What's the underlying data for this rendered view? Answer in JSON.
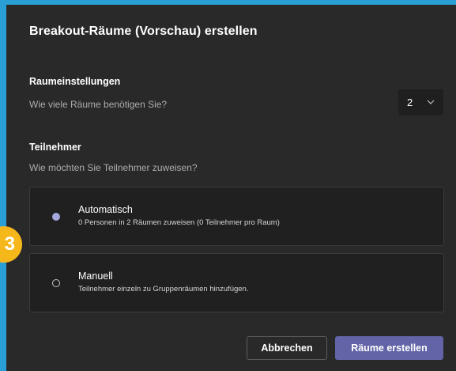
{
  "dialog": {
    "title": "Breakout-Räume (Vorschau) erstellen"
  },
  "room_settings": {
    "heading": "Raumeinstellungen",
    "question": "Wie viele Räume benötigen Sie?",
    "room_count": "2"
  },
  "participants": {
    "heading": "Teilnehmer",
    "question": "Wie möchten Sie Teilnehmer zuweisen?",
    "options": [
      {
        "label": "Automatisch",
        "description": "0 Personen in 2 Räumen zuweisen (0 Teilnehmer pro Raum)",
        "selected": true
      },
      {
        "label": "Manuell",
        "description": "Teilnehmer einzeln zu Gruppenräumen hinzufügen.",
        "selected": false
      }
    ]
  },
  "actions": {
    "cancel_label": "Abbrechen",
    "create_label": "Räume erstellen"
  },
  "step_badge": "3",
  "colors": {
    "accent": "#6264a7",
    "dialog_bg": "#292929",
    "badge": "#f6b71b",
    "frame": "#2a9fd6"
  },
  "icons": {
    "select_arrow": "chevron-down-icon",
    "selected_option": "radio-selected-icon",
    "unselected_option": "radio-unselected-icon"
  }
}
